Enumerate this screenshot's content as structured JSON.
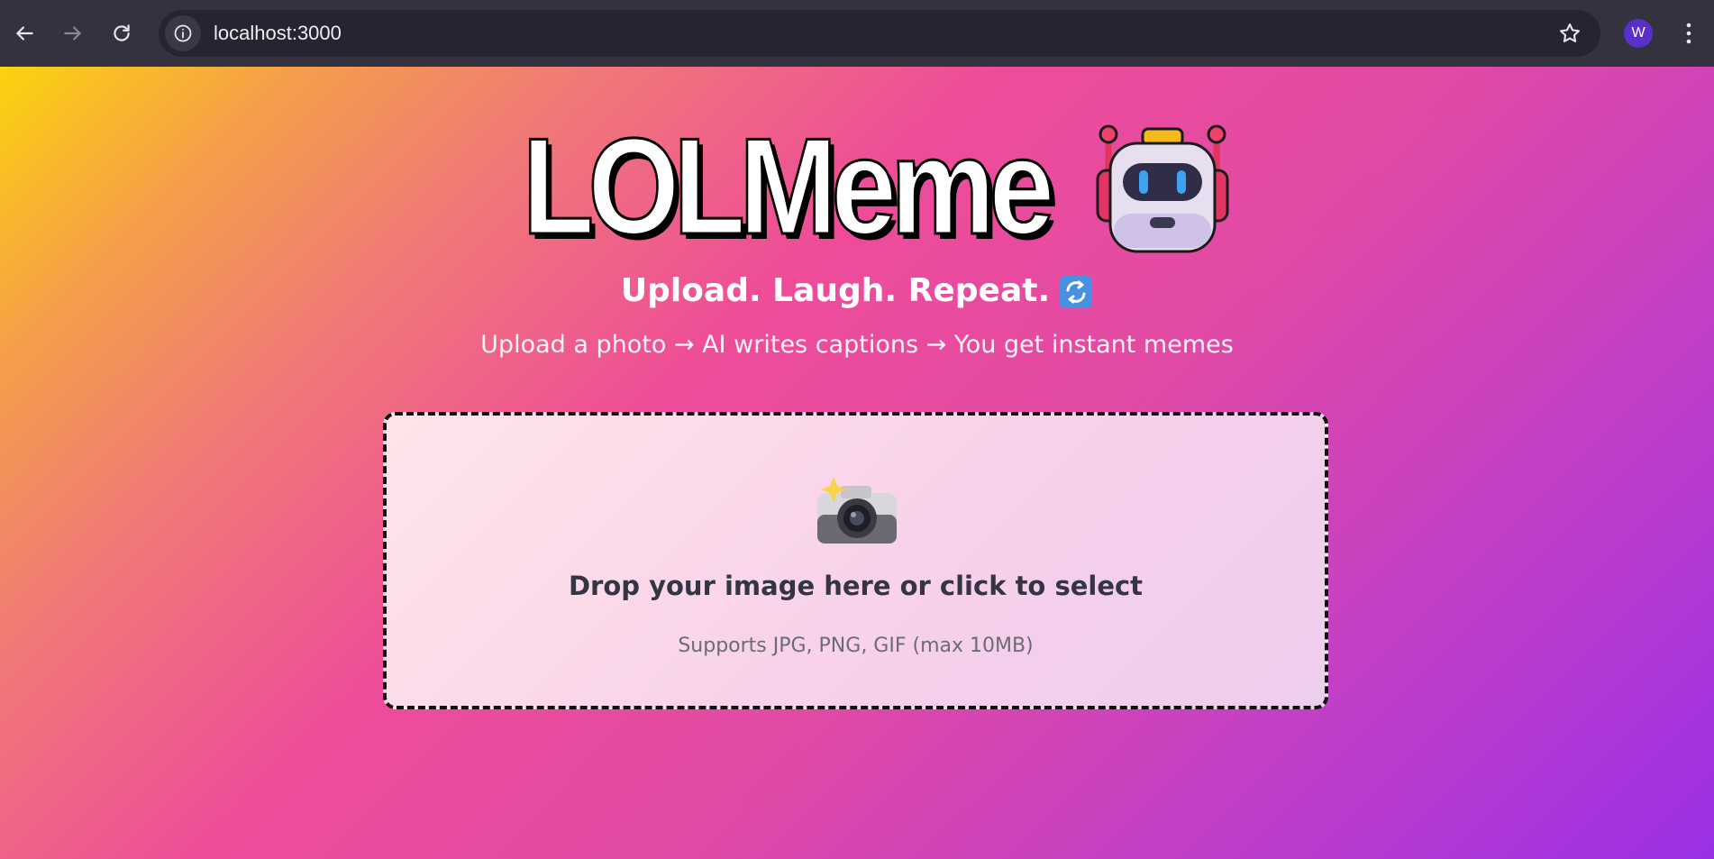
{
  "browser": {
    "url": "localhost:3000",
    "profile_initial": "W",
    "icons": {
      "back": "back-arrow-icon",
      "forward": "forward-arrow-icon",
      "reload": "reload-icon",
      "site_info": "info-icon",
      "bookmark": "star-icon",
      "menu": "kebab-menu-icon"
    }
  },
  "hero": {
    "title": "LOLMeme",
    "title_icon": "robot-emoji",
    "tagline": "Upload. Laugh. Repeat.",
    "tagline_icon": "repeat-arrows-emoji",
    "subtitle": "Upload a photo → AI writes captions → You get instant memes"
  },
  "dropzone": {
    "icon": "camera-flash-emoji",
    "title": "Drop your image here or click to select",
    "hint": "Supports JPG, PNG, GIF (max 10MB)"
  },
  "colors": {
    "gradient_start": "#fcd30e",
    "gradient_mid": "#ee4c99",
    "gradient_end": "#9b30e6",
    "browser_chrome": "#35323f",
    "avatar": "#5b2fc9"
  }
}
